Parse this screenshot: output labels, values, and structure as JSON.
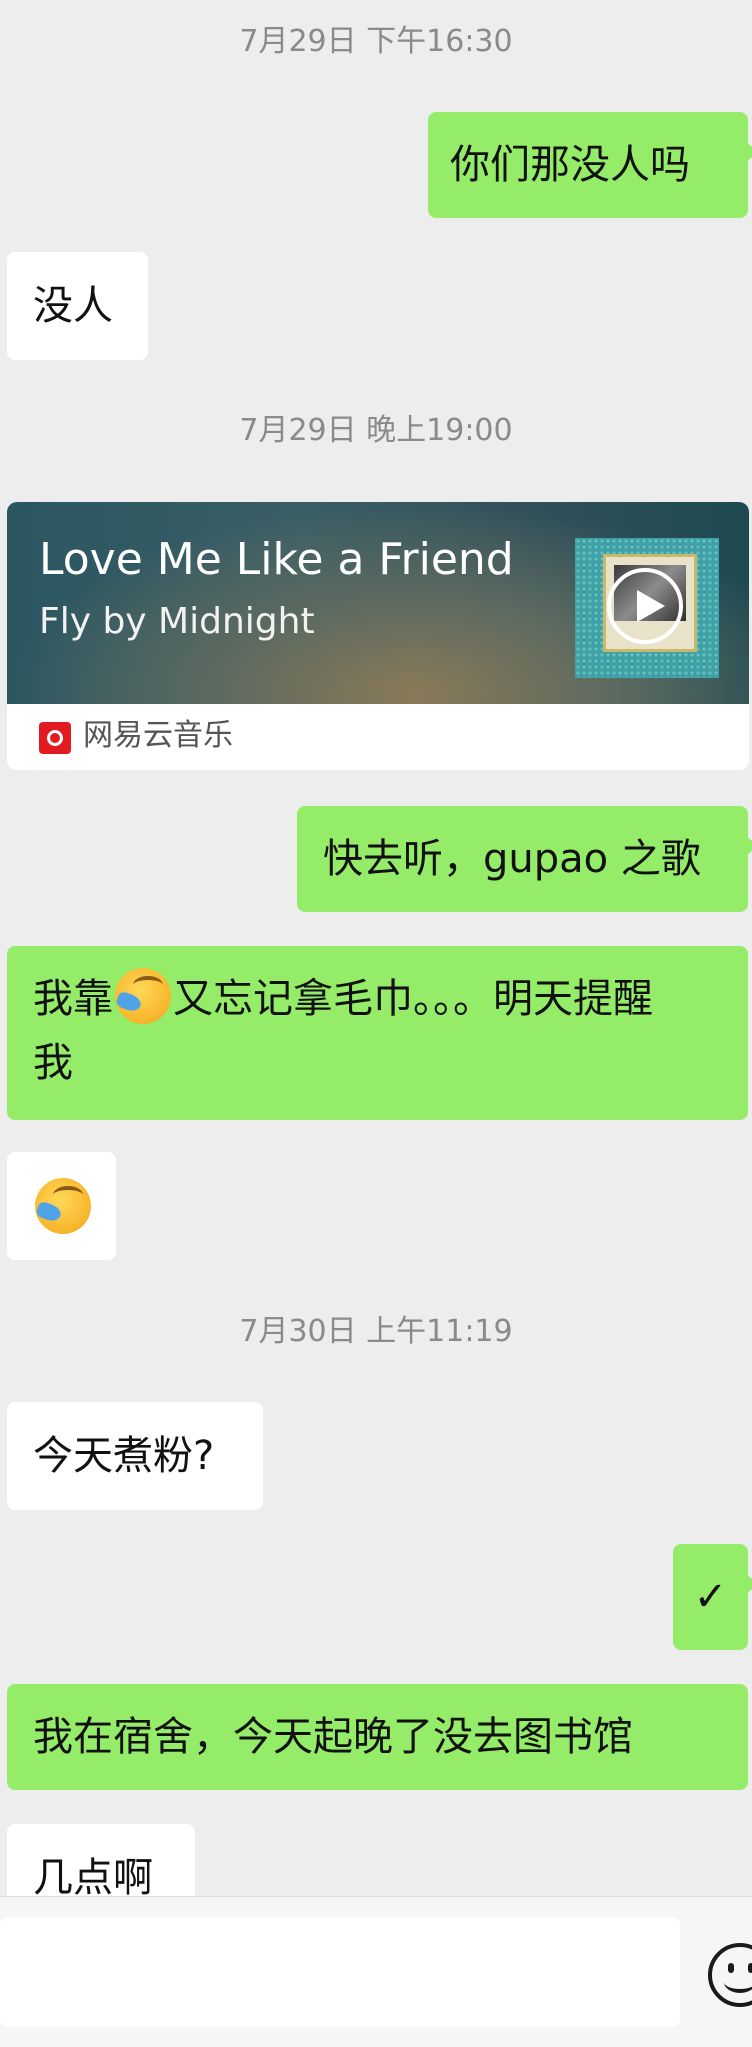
{
  "timestamps": [
    "7月29日 下午16:30",
    "7月29日 晚上19:00",
    "7月30日 上午11:19"
  ],
  "messages": {
    "m1": "你们那没人吗",
    "m2": "没人",
    "m4": "快去听，gupao 之歌",
    "m5a": "我靠",
    "m5b": "又忘记拿毛巾。。。明天提醒",
    "m5c": "我",
    "m7": "今天煮粉?",
    "m8": "✓",
    "m9": "我在宿舍，今天起晚了没去图书馆",
    "m10": "几点啊"
  },
  "music_card": {
    "title": "Love Me Like a Friend",
    "artist": "Fly by Midnight",
    "source": "网易云音乐"
  },
  "colors": {
    "sent_bubble": "#95ec69",
    "received_bubble": "#ffffff",
    "background": "#ededed"
  },
  "icons": [
    "play-icon",
    "netease-music-icon",
    "facepalm-emoji",
    "emoji-smiley-icon"
  ]
}
